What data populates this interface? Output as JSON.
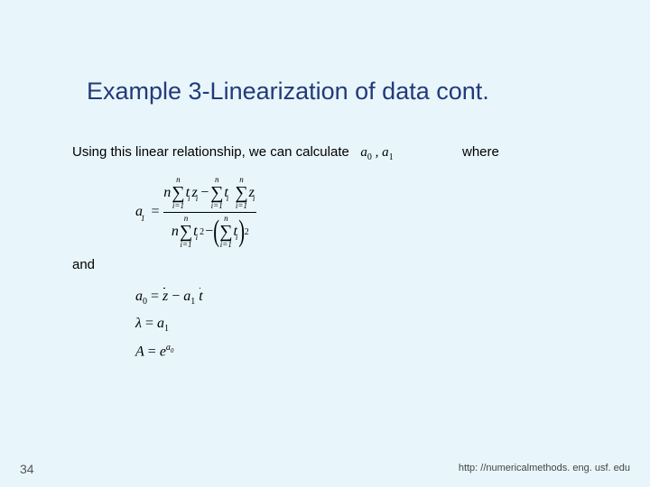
{
  "title": "Example 3-Linearization of data cont.",
  "line1": "Using this linear relationship, we can calculate",
  "coeff_a0": "a",
  "coeff_a0_sub": "0",
  "coeff_sep": ", ",
  "coeff_a1": "a",
  "coeff_a1_sub": "1",
  "where": "where",
  "and": "and",
  "eq_a1_lhs_var": "a",
  "eq_a1_lhs_sub": "1",
  "eq_eq": " = ",
  "n": "n",
  "i": "i",
  "i1": "i=1",
  "t": "t",
  "z": "z",
  "minus": " − ",
  "sq": "2",
  "eq2_a0": "a",
  "eq2_a0_sub": "0",
  "eq2_rhs_zbar": "z",
  "eq2_minus": " − ",
  "eq2_a1": "a",
  "eq2_a1_sub": "1",
  "eq2_tbar": "t",
  "eq3_lambda": "λ",
  "eq3_eq": " = ",
  "eq3_a1": "a",
  "eq3_a1_sub": "1",
  "eq4_A": "A",
  "eq4_eq": " = ",
  "eq4_e": "e",
  "eq4_a0": "a",
  "eq4_a0_sub": "0",
  "slide_number": "34",
  "footer_url": "http: //numericalmethods. eng. usf. edu"
}
